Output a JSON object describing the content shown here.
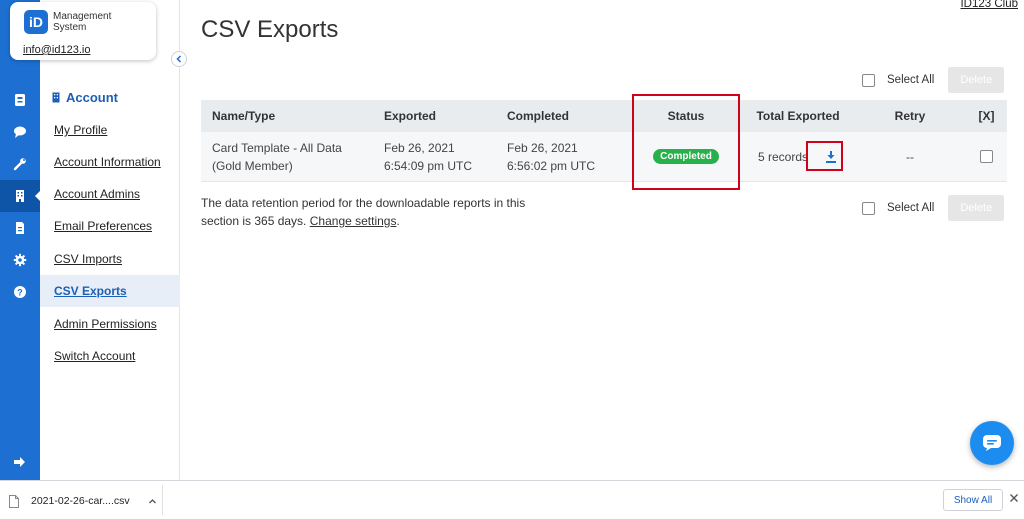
{
  "app": {
    "logo_letters": "iD",
    "logo_text": "Management System",
    "user_email": "info@id123.io",
    "club_name": "ID123 Club"
  },
  "rail": {
    "icons": [
      "id-card-icon",
      "chat-icon",
      "wrench-icon",
      "building-icon",
      "document-icon",
      "gear-icon",
      "help-icon",
      "sign-out-icon"
    ],
    "active": "building-icon"
  },
  "nav": {
    "heading": "Account",
    "items": [
      {
        "label": "My Profile"
      },
      {
        "label": "Account Information"
      },
      {
        "label": "Account Admins"
      },
      {
        "label": "Email Preferences"
      },
      {
        "label": "CSV Imports"
      },
      {
        "label": "CSV Exports",
        "active": true
      },
      {
        "label": "Admin Permissions"
      },
      {
        "label": "Switch Account"
      }
    ]
  },
  "page": {
    "title": "CSV Exports",
    "select_all_label": "Select All",
    "delete_label": "Delete",
    "retention_text": "The data retention period for the downloadable reports in this section is 365 days.",
    "change_settings_label": "Change settings",
    "retention_suffix": "."
  },
  "table": {
    "columns": [
      "Name/Type",
      "Exported",
      "Completed",
      "Status",
      "Total Exported",
      "Retry",
      "[X]"
    ],
    "rows": [
      {
        "name_line1": "Card Template - All Data",
        "name_line2": "(Gold Member)",
        "exported_date": "Feb 26, 2021",
        "exported_time": "6:54:09 pm UTC",
        "completed_date": "Feb 26, 2021",
        "completed_time": "6:56:02 pm UTC",
        "status": "Completed",
        "total_exported": "5 records",
        "retry": "--"
      }
    ]
  },
  "download_bar": {
    "file_name": "2021-02-26-car....csv",
    "show_all_label": "Show All"
  },
  "colors": {
    "brand_blue": "#1d6fd1",
    "status_green": "#27b04b",
    "highlight_red": "#d0021b"
  }
}
